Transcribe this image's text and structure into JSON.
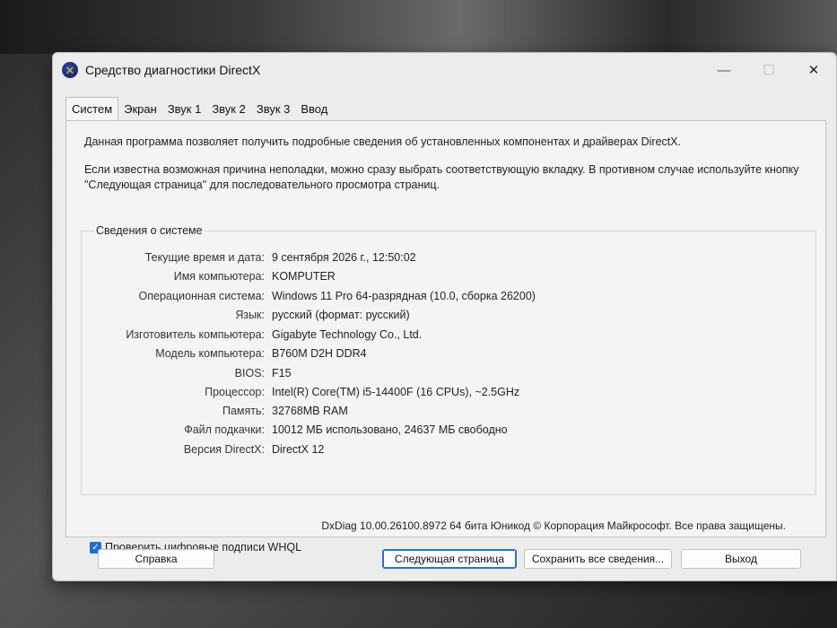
{
  "window": {
    "title": "Средство диагностики DirectX",
    "controls": {
      "minimize": "—",
      "maximize": "☐",
      "close": "✕"
    }
  },
  "tabs": [
    {
      "label": "Систем"
    },
    {
      "label": "Экран"
    },
    {
      "label": "Звук 1"
    },
    {
      "label": "Звук 2"
    },
    {
      "label": "Звук 3"
    },
    {
      "label": "Ввод"
    }
  ],
  "intro": {
    "line1": "Данная программа позволяет получить подробные сведения об установленных компонентах и драйверах DirectX.",
    "line2": "Если известна возможная причина неполадки, можно сразу выбрать соответствующую вкладку. В противном случае используйте кнопку \"Следующая страница\" для последовательного просмотра страниц."
  },
  "system_info": {
    "title": "Сведения о системе",
    "rows": [
      {
        "label": "Текущие время и дата:",
        "value": "9 сентября 2026 г., 12:50:02"
      },
      {
        "label": "Имя компьютера:",
        "value": "KOMPUTER"
      },
      {
        "label": "Операционная система:",
        "value": "Windows 11 Pro 64-разрядная (10.0, сборка 26200)"
      },
      {
        "label": "Язык:",
        "value": "русский (формат: русский)"
      },
      {
        "label": "Изготовитель компьютера:",
        "value": "Gigabyte Technology Co., Ltd."
      },
      {
        "label": "Модель компьютера:",
        "value": "B760M D2H DDR4"
      },
      {
        "label": "BIOS:",
        "value": "F15"
      },
      {
        "label": "Процессор:",
        "value": "Intel(R) Core(TM) i5-14400F (16 CPUs), ~2.5GHz"
      },
      {
        "label": "Память:",
        "value": "32768MB RAM"
      },
      {
        "label": "Файл подкачки:",
        "value": "10012 МБ использовано, 24637 МБ свободно"
      },
      {
        "label": "Версия DirectX:",
        "value": "DirectX 12"
      }
    ]
  },
  "whql": {
    "label": "Проверить цифровые подписи WHQL",
    "checked": true,
    "check_glyph": "✓"
  },
  "footer": "DxDiag 10.00.26100.8972 64 бита Юникод © Корпорация Майкрософт. Все права защищены.",
  "buttons": {
    "help": "Справка",
    "next": "Следующая страница",
    "save": "Сохранить все сведения...",
    "exit": "Выход"
  },
  "icons": {
    "app": "directx-icon"
  },
  "colors": {
    "accent": "#2e6fc9",
    "checkbox": "#1e6fd1"
  }
}
